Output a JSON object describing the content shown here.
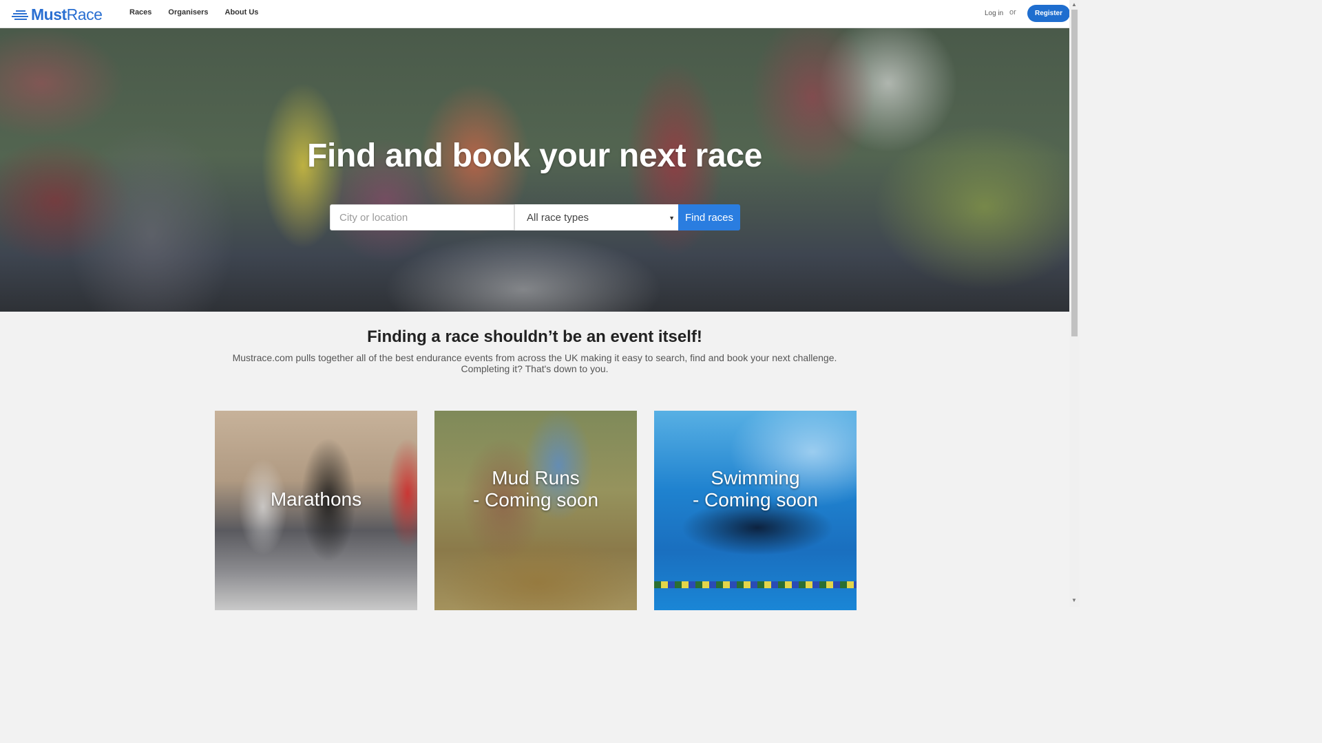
{
  "header": {
    "logo_left": "Must",
    "logo_right": "Race",
    "nav": [
      "Races",
      "Organisers",
      "About Us"
    ],
    "login": "Log in",
    "or": "or",
    "register": "Register"
  },
  "hero": {
    "title": "Find and book your next race",
    "search_placeholder": "City or location",
    "race_type_selected": "All race types",
    "find_button": "Find races"
  },
  "intro": {
    "heading": "Finding a race shouldn’t be an event itself!",
    "body": "Mustrace.com pulls together all of the best endurance events from across the UK making it easy to search, find and book your next challenge. Completing it? That's down to you."
  },
  "cards": [
    {
      "line1": "Marathons",
      "line2": ""
    },
    {
      "line1": "Mud Runs",
      "line2": "- Coming soon"
    },
    {
      "line1": "Swimming",
      "line2": "- Coming soon"
    }
  ],
  "colors": {
    "brand": "#2a6fd1",
    "button": "#1f6ecf",
    "find_button": "#2a7de0"
  }
}
